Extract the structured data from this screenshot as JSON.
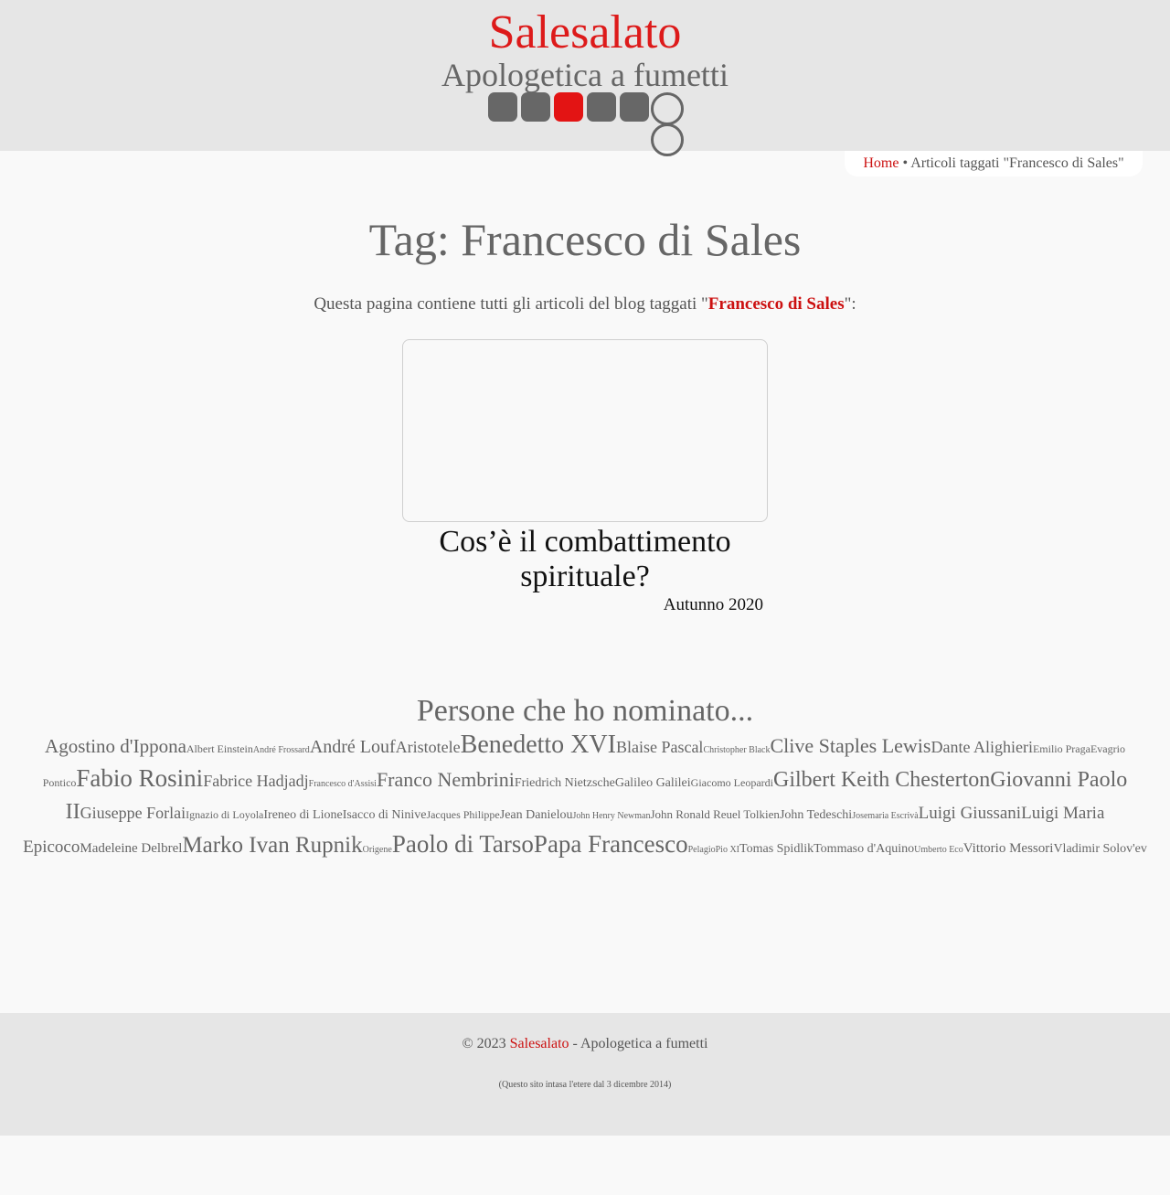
{
  "header": {
    "site_title": "Salesalato",
    "site_subtitle": "Apologetica a fumetti",
    "nav_squares": [
      {
        "active": false
      },
      {
        "active": false
      },
      {
        "active": true
      },
      {
        "active": false
      },
      {
        "active": false
      }
    ],
    "accent_color": "#dd1a1a"
  },
  "breadcrumb": {
    "home_label": "Home",
    "separator": " • ",
    "current": "Articoli taggati \"Francesco di Sales\""
  },
  "page": {
    "title": "Tag: Francesco di Sales",
    "intro_prefix": "Questa pagina contiene tutti gli articoli del blog taggati \"",
    "intro_tag": "Francesco di Sales",
    "intro_suffix": "\":"
  },
  "article": {
    "title": "Cos’è il combattimento spirituale?",
    "date": "Autunno 2020"
  },
  "cloud": {
    "heading": "Persone che ho nominato...",
    "tags": [
      {
        "label": "Agostino d'Ippona",
        "size": 21
      },
      {
        "label": "Albert Einstein",
        "size": 12
      },
      {
        "label": "André Frossard",
        "size": 10
      },
      {
        "label": "André Louf",
        "size": 20
      },
      {
        "label": "Aristotele",
        "size": 18
      },
      {
        "label": "Benedetto XVI",
        "size": 28
      },
      {
        "label": "Blaise Pascal",
        "size": 18
      },
      {
        "label": "Christopher Black",
        "size": 10
      },
      {
        "label": "Clive Staples Lewis",
        "size": 22
      },
      {
        "label": "Dante Alighieri",
        "size": 18
      },
      {
        "label": "Emilio Praga",
        "size": 12
      },
      {
        "label": "Evagrio Pontico",
        "size": 12
      },
      {
        "label": "Fabio Rosini",
        "size": 27
      },
      {
        "label": "Fabrice Hadjadj",
        "size": 18
      },
      {
        "label": "Francesco d'Assisi",
        "size": 10
      },
      {
        "label": "Franco Nembrini",
        "size": 22
      },
      {
        "label": "Friedrich Nietzsche",
        "size": 14
      },
      {
        "label": "Galileo Galilei",
        "size": 14
      },
      {
        "label": "Giacomo Leopardi",
        "size": 12
      },
      {
        "label": "Gilbert Keith Chesterton",
        "size": 24
      },
      {
        "label": "Giovanni Paolo II",
        "size": 24
      },
      {
        "label": "Giuseppe Forlai",
        "size": 18
      },
      {
        "label": "Ignazio di Loyola",
        "size": 12
      },
      {
        "label": "Ireneo di Lione",
        "size": 14
      },
      {
        "label": "Isacco di Ninive",
        "size": 14
      },
      {
        "label": "Jacques Philippe",
        "size": 12
      },
      {
        "label": "Jean Danielou",
        "size": 14
      },
      {
        "label": "John Henry Newman",
        "size": 10
      },
      {
        "label": "John Ronald Reuel Tolkien",
        "size": 13
      },
      {
        "label": "John Tedeschi",
        "size": 14
      },
      {
        "label": "Josemaria Escrivà",
        "size": 10
      },
      {
        "label": "Luigi Giussani",
        "size": 19
      },
      {
        "label": "Luigi Maria Epicoco",
        "size": 19
      },
      {
        "label": "Madeleine Delbrel",
        "size": 15
      },
      {
        "label": "Marko Ivan Rupnik",
        "size": 25
      },
      {
        "label": "Origene",
        "size": 10
      },
      {
        "label": "Paolo di Tarso",
        "size": 27
      },
      {
        "label": "Papa Francesco",
        "size": 27
      },
      {
        "label": "Pelagio",
        "size": 10
      },
      {
        "label": "Pio XI",
        "size": 10
      },
      {
        "label": "Tomas Spidlik",
        "size": 14
      },
      {
        "label": "Tommaso d'Aquino",
        "size": 14
      },
      {
        "label": "Umberto Eco",
        "size": 10
      },
      {
        "label": "Vittorio Messori",
        "size": 15
      },
      {
        "label": "Vladimir Solov'ev",
        "size": 14
      }
    ]
  },
  "footer": {
    "copyright_prefix": "© 2023 ",
    "site_link": "Salesalato",
    "copyright_suffix": " - Apologetica a fumetti",
    "note": "(Questo sito intasa l'etere dal 3 dicembre 2014)"
  }
}
